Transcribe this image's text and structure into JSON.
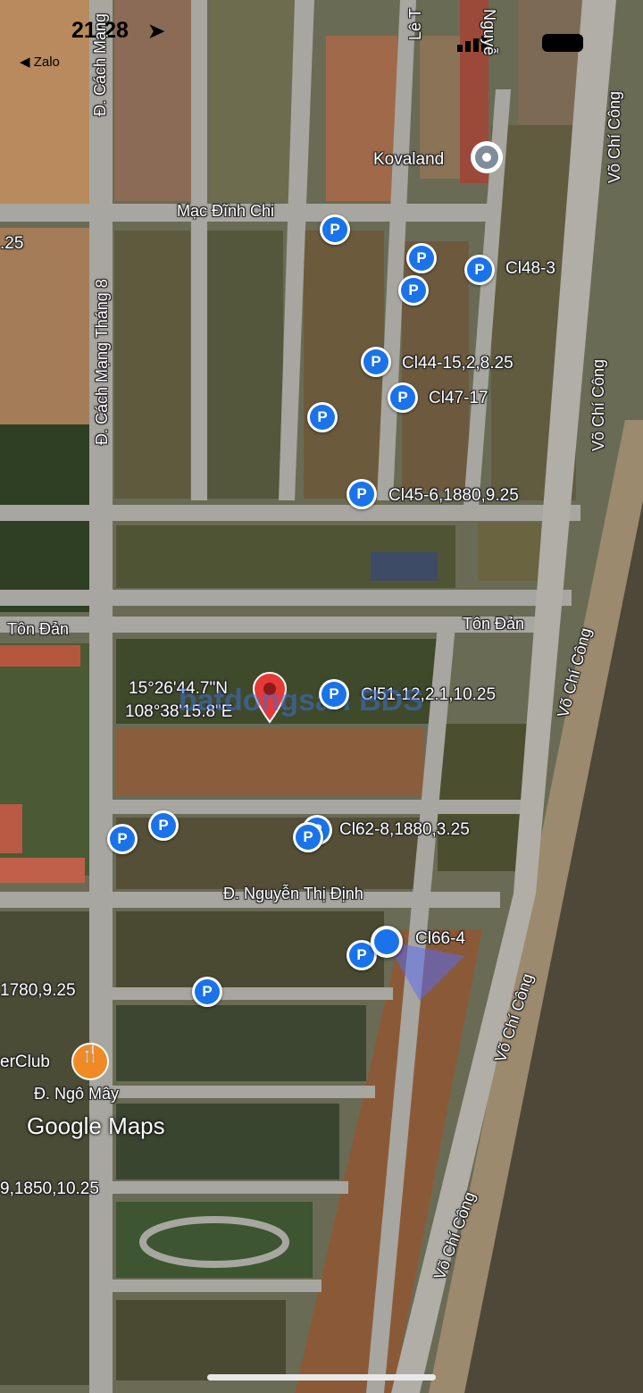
{
  "status_bar": {
    "time": "21:28",
    "back_label": "◀ Zalo"
  },
  "map": {
    "coords": {
      "lat": "15°26'44.7\"N",
      "lng": "108°38'15.8\"E"
    },
    "watermark": "batdongsan BDS",
    "google_logo": "Google Maps",
    "streets": {
      "cach_mang_top": "Đ. Cách Mạng",
      "cach_mang_thang8": "Đ. Cách Mạng Tháng 8",
      "le_t": "Lê T",
      "nguyen_top": "Nguyễ",
      "mac_dinh_chi": "Mạc Đĩnh Chi",
      "ton_dan_left": "Tôn Đản",
      "ton_dan_right": "Tôn Đản",
      "nguyen_thi_dinh": "Đ. Nguyễn Thị Định",
      "ngo_may": "Đ. Ngô Mây",
      "vo_chi_cong_1": "Võ Chí Công",
      "vo_chi_cong_2": "Võ Chí Công",
      "vo_chi_cong_3": "Võ Chí Công",
      "vo_chi_cong_4": "Võ Chí Công",
      "vo_chi_cong_5": "Võ Chí Công"
    },
    "places": {
      "kovaland": "Kovaland",
      "club": "erClub"
    },
    "parcel_labels": {
      "cl48": "Cl48-3",
      "cl44": "Cl44-15,2,8.25",
      "cl47": "Cl47-17",
      "cl45": "Cl45-6,1880,9.25",
      "cl51": "Cl51-12,2.1,10.25",
      "cl62": "Cl62-8,1880,3.25",
      "cl66": "Cl66-4",
      "left_1780": "1780,9.25",
      "left_1850": "9,1850,10.25",
      "left_25": ".25"
    },
    "pin_icon": "parking-p-icon",
    "colors": {
      "pin": "#1a73e8",
      "red_marker": "#e53935",
      "water": "#4e4838",
      "road": "#a8a6a0"
    }
  }
}
